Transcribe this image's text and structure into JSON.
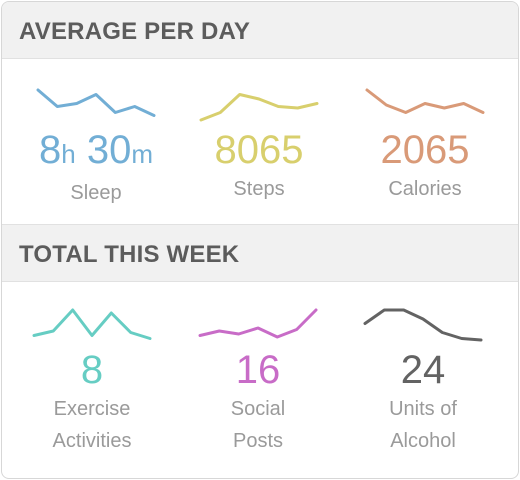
{
  "sections": {
    "average": {
      "title": "AVERAGE PER DAY"
    },
    "total": {
      "title": "TOTAL THIS WEEK"
    }
  },
  "metrics": {
    "sleep": {
      "hours": "8",
      "h_unit": "h",
      "minutes": "30",
      "m_unit": "m",
      "label": "Sleep",
      "color": "#72aed5",
      "trend": [
        0.0,
        0.55,
        0.45,
        0.15,
        0.75,
        0.55,
        0.85
      ]
    },
    "steps": {
      "value": "8065",
      "label": "Steps",
      "color": "#d8cf6d",
      "trend": [
        1.0,
        0.75,
        0.15,
        0.3,
        0.55,
        0.6,
        0.45
      ]
    },
    "calories": {
      "value": "2065",
      "label": "Calories",
      "color": "#d99a78",
      "trend": [
        0.0,
        0.5,
        0.75,
        0.45,
        0.6,
        0.45,
        0.75
      ]
    },
    "exercise": {
      "value": "8",
      "label_line1": "Exercise",
      "label_line2": "Activities",
      "color": "#66cdc3",
      "trend": [
        0.85,
        0.7,
        0.0,
        0.85,
        0.1,
        0.75,
        0.95
      ]
    },
    "social": {
      "value": "16",
      "label_line1": "Social",
      "label_line2": "Posts",
      "color": "#c86cc7",
      "trend": [
        0.85,
        0.7,
        0.8,
        0.6,
        0.9,
        0.65,
        0.0
      ]
    },
    "alcohol": {
      "value": "24",
      "label_line1": "Units of",
      "label_line2": "Alcohol",
      "color": "#636363",
      "trend": [
        0.45,
        0.0,
        0.0,
        0.3,
        0.75,
        0.95,
        1.0
      ]
    }
  }
}
